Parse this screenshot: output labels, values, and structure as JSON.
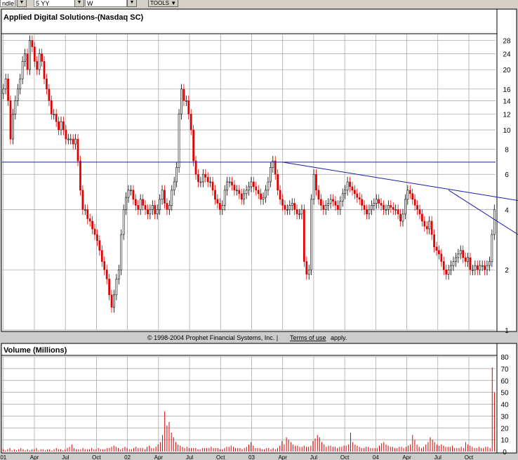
{
  "toolbar": {
    "type_field": "ndle",
    "range_field": "5 YY",
    "period_field": "W",
    "tools_button": "TOOLS"
  },
  "header": {
    "title": "Applied Digital Solutions-(Nasdaq SC)"
  },
  "copyright": {
    "prefix": "© 1998-2004 Prophet Financial Systems, Inc. |",
    "link": "Terms of use",
    "suffix": "apply."
  },
  "volume_panel": {
    "title": "Volume (Millions)"
  },
  "colors": {
    "up": "#000000",
    "down": "#e00000",
    "trendline": "#1a1aa8",
    "volume": "#e00000",
    "grid": "#a0a0a0",
    "background": "#ffffff"
  },
  "chart_data": [
    {
      "type": "candlestick",
      "title": "Applied Digital Solutions-(Nasdaq SC)",
      "y_scale": "log",
      "ylim": [
        1,
        30
      ],
      "y_ticks": [
        1,
        2,
        4,
        6,
        8,
        10,
        12,
        14,
        16,
        20,
        24,
        28
      ],
      "x_tick_labels": [
        "01",
        "Apr",
        "Jul",
        "Oct",
        "02",
        "Apr",
        "Jul",
        "Oct",
        "03",
        "Apr",
        "Jul",
        "Oct",
        "04",
        "Apr",
        "Jul",
        "Oct"
      ],
      "grid": true,
      "close_series": [
        16,
        18,
        14,
        9,
        12,
        14,
        16,
        18,
        22,
        24,
        20,
        28,
        26,
        22,
        20,
        24,
        22,
        18,
        16,
        14,
        12,
        12,
        11,
        10,
        11,
        10,
        9,
        9,
        9,
        8.5,
        9,
        7,
        5,
        4,
        4,
        3.6,
        3.5,
        3.2,
        3,
        2.8,
        2.5,
        2.2,
        2,
        1.8,
        1.5,
        1.3,
        1.5,
        1.8,
        2,
        3,
        4,
        4.6,
        5,
        5,
        4.5,
        4.2,
        4,
        4.5,
        4.2,
        4,
        3.8,
        4,
        4.2,
        3.8,
        4,
        4.5,
        5,
        4.3,
        4,
        4.2,
        5,
        5.5,
        6.5,
        12,
        16,
        14,
        14,
        12,
        10,
        7,
        6,
        5.5,
        5.5,
        6,
        5.8,
        5.5,
        5.5,
        5,
        4.5,
        4.3,
        4,
        4.2,
        5,
        5.5,
        5.5,
        5.3,
        5,
        5,
        4.8,
        4.5,
        4.8,
        5,
        5.2,
        5.5,
        5.2,
        5,
        4.8,
        4.5,
        4.6,
        5,
        5.5,
        6.5,
        7,
        6,
        5,
        4.5,
        4.2,
        4,
        4,
        4.2,
        4.3,
        4,
        3.8,
        3.8,
        4,
        2.2,
        1.9,
        2,
        4.5,
        6,
        5,
        4.5,
        4.2,
        4,
        4.2,
        4.3,
        4.5,
        4.4,
        4.2,
        4,
        4.4,
        4.8,
        5,
        5.5,
        5.2,
        5,
        4.8,
        4.6,
        4.5,
        4.2,
        4,
        3.8,
        4,
        4.2,
        4.3,
        4.5,
        4.3,
        4.2,
        4,
        4,
        4.2,
        4.1,
        4,
        4,
        3.8,
        3.5,
        3.8,
        4.5,
        5,
        4.8,
        4.5,
        4.2,
        4,
        3.8,
        3.5,
        3.3,
        3.2,
        3.5,
        3,
        2.6,
        2.5,
        2.4,
        2.2,
        2,
        1.9,
        2,
        2.1,
        2.2,
        2.3,
        2.4,
        2.5,
        2.3,
        2.2,
        2.3,
        2,
        2,
        2.1,
        2,
        2.1,
        2.1,
        2,
        2.1,
        2.2,
        3,
        4
      ],
      "reference_lines": [
        {
          "kind": "horizontal",
          "y": 6.9
        },
        {
          "kind": "trendline",
          "from": [
            116,
            6.9
          ],
          "to": [
            237,
            4.0
          ]
        },
        {
          "kind": "trendline",
          "from": [
            185,
            5.0
          ],
          "to": [
            234,
            2.1
          ]
        }
      ]
    },
    {
      "type": "bar",
      "title": "Volume (Millions)",
      "ylim": [
        0,
        80
      ],
      "y_ticks": [
        0,
        10,
        20,
        30,
        40,
        50,
        60,
        70,
        80
      ],
      "values": [
        2,
        1,
        2,
        3,
        1,
        2,
        1,
        2,
        3,
        2,
        1,
        2,
        1,
        2,
        2,
        3,
        1,
        2,
        2,
        1,
        2,
        2,
        1,
        2,
        3,
        2,
        2,
        1,
        2,
        3,
        4,
        6,
        3,
        2,
        2,
        2,
        3,
        2,
        2,
        2,
        3,
        2,
        2,
        3,
        2,
        2,
        2,
        3,
        3,
        4,
        5,
        4,
        3,
        2,
        3,
        4,
        3,
        2,
        2,
        3,
        4,
        3,
        3,
        3,
        2,
        4,
        5,
        3,
        3,
        4,
        6,
        8,
        14,
        34,
        22,
        25,
        16,
        12,
        8,
        6,
        5,
        4,
        3,
        4,
        3,
        3,
        3,
        3,
        2,
        2,
        3,
        3,
        3,
        3,
        4,
        3,
        3,
        3,
        2,
        2,
        3,
        4,
        4,
        5,
        4,
        3,
        3,
        3,
        2,
        3,
        4,
        6,
        8,
        5,
        3,
        3,
        3,
        2,
        2,
        3,
        3,
        2,
        3,
        2,
        3,
        5,
        9,
        6,
        12,
        10,
        8,
        6,
        5,
        5,
        4,
        4,
        5,
        4,
        4,
        5,
        9,
        11,
        14,
        12,
        8,
        6,
        4,
        5,
        5,
        4,
        4,
        3,
        4,
        4,
        5,
        5,
        6,
        16,
        8,
        6,
        5,
        4,
        3,
        3,
        4,
        4,
        3,
        3,
        3,
        3,
        5,
        7,
        8,
        6,
        5,
        4,
        4,
        3,
        3,
        4,
        4,
        3,
        4,
        5,
        6,
        14,
        10,
        6,
        4,
        3,
        4,
        6,
        8,
        12,
        10,
        8,
        6,
        5,
        6,
        5,
        4,
        4,
        4,
        5,
        3,
        3,
        3,
        4,
        3,
        8,
        6,
        5,
        4,
        3,
        3,
        4,
        3,
        3,
        4,
        4,
        3,
        71,
        50
      ]
    }
  ]
}
